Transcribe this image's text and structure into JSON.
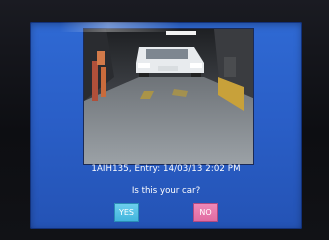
{
  "plate_entry": {
    "text": "1AIH135, Entry: 14/03/13 2:02 PM"
  },
  "prompt": {
    "question": "Is this your car?"
  },
  "actions": {
    "yes_label": "YES",
    "no_label": "NO"
  },
  "colors": {
    "screen_background": "#2a5fc8",
    "yes_button": "#4dbfe4",
    "no_button": "#e878ad",
    "text": "#ffffff"
  }
}
